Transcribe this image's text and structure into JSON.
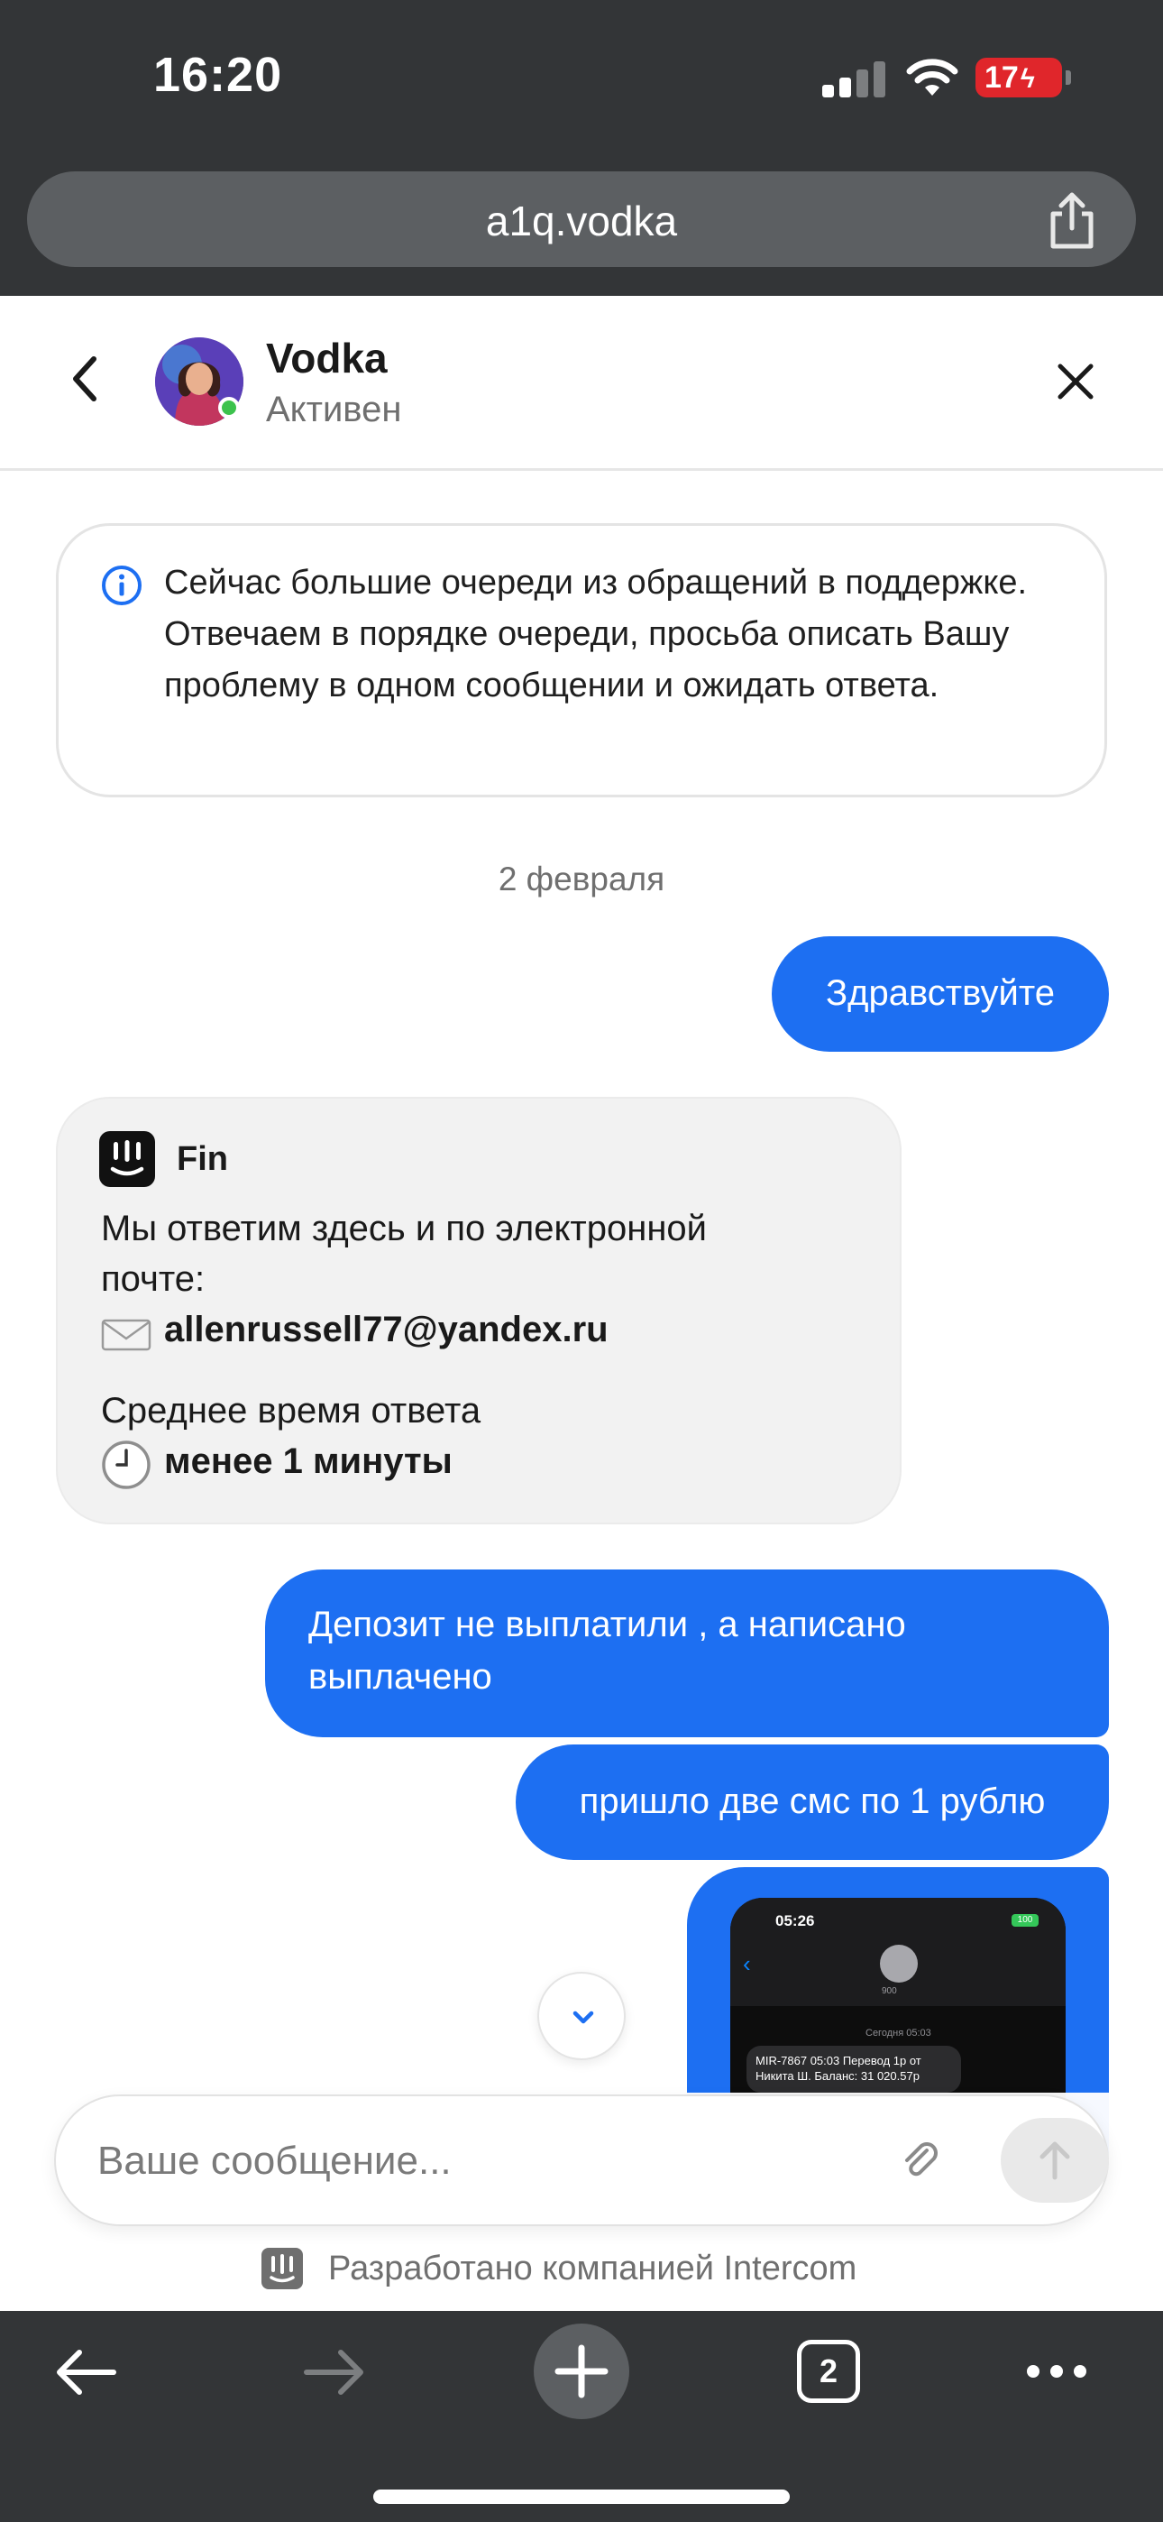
{
  "status_bar": {
    "time": "16:20",
    "battery": "17"
  },
  "browser": {
    "url": "a1q.vodka",
    "tab_count": "2"
  },
  "header": {
    "agent_name": "Vodka",
    "agent_status": "Активен"
  },
  "notice": {
    "text": "Сейчас большие очереди из обращений в поддержке. Отвечаем в порядке очереди, просьба описать Вашу проблему в одном сообщении и ожидать ответа."
  },
  "conversation": {
    "date_separator": "2 февраля",
    "message_1": "Здравствуйте",
    "bot_card": {
      "bot_name": "Fin",
      "reply_line_1": "Мы ответим здесь и по электронной",
      "reply_line_2": "почте:",
      "email": "allenrussell77@yandex.ru",
      "avg_time_label": "Среднее время ответа",
      "avg_time_value": "менее 1 минуты"
    },
    "message_2": "Депозит не выплатили , а написано выплачено",
    "message_3": "пришло две смс по 1 рублю",
    "attachment": {
      "time": "05:26",
      "battery": "100",
      "sender": "900",
      "date": "Сегодня 05:03",
      "sms_text": "MIR-7867 05:03 Перевод 1р от Никита Ш. Баланс: 31 020.57р"
    }
  },
  "composer": {
    "placeholder": "Ваше сообщение..."
  },
  "footer": {
    "powered_by": "Разработано компанией Intercom"
  },
  "colors": {
    "accent": "#1d6ff2",
    "chrome": "#333537",
    "online": "#3cc24d",
    "battery_low": "#e0262b"
  }
}
